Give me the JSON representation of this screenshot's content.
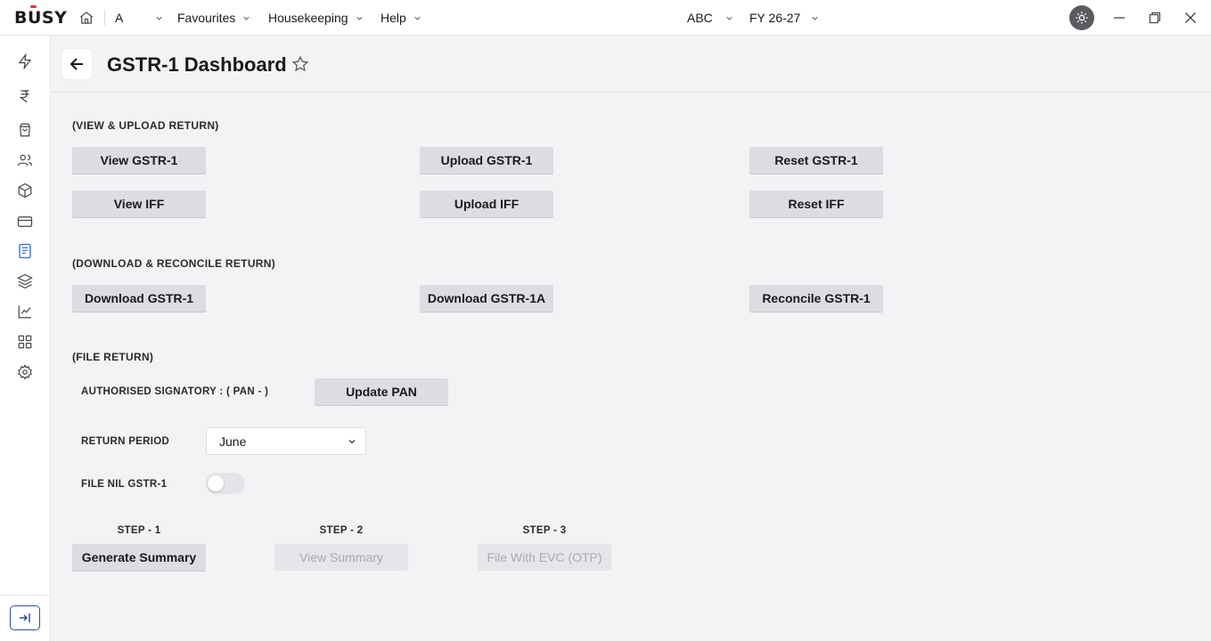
{
  "topbar": {
    "logo": "BUSY",
    "company_short": "A",
    "menus": [
      "Favourites",
      "Housekeeping",
      "Help"
    ],
    "company": "ABC",
    "fiscal_year": "FY 26-27"
  },
  "header": {
    "title": "GSTR-1 Dashboard"
  },
  "view_upload": {
    "label": "(VIEW & UPLOAD RETURN)",
    "view_gstr1": "View GSTR-1",
    "upload_gstr1": "Upload GSTR-1",
    "reset_gstr1": "Reset GSTR-1",
    "view_iff": "View IFF",
    "upload_iff": "Upload IFF",
    "reset_iff": "Reset IFF"
  },
  "download": {
    "label": "(DOWNLOAD & RECONCILE RETURN)",
    "download_gstr1": "Download GSTR-1",
    "download_gstr1a": "Download GSTR-1A",
    "reconcile_gstr1": "Reconcile GSTR-1"
  },
  "file_return": {
    "label": "(FILE RETURN)",
    "signatory_label": "AUTHORISED SIGNATORY : ( PAN -  )",
    "update_pan": "Update PAN",
    "return_period_label": "RETURN PERIOD",
    "return_period_value": "June",
    "file_nil_label": "FILE NIL GSTR-1",
    "file_nil_on": false,
    "steps": [
      {
        "label": "STEP - 1",
        "button": "Generate Summary",
        "enabled": true
      },
      {
        "label": "STEP - 2",
        "button": "View Summary",
        "enabled": false
      },
      {
        "label": "STEP - 3",
        "button": "File With EVC (OTP)",
        "enabled": false
      }
    ]
  },
  "sidebar": {
    "icons": [
      "lightning-icon",
      "rupee-icon",
      "shopping-bag-icon",
      "users-icon",
      "box-icon",
      "card-icon",
      "document-icon",
      "layers-icon",
      "chart-icon",
      "grid-icon",
      "gear-icon"
    ],
    "active": "document-icon"
  },
  "colors": {
    "accent": "#2b4f9e",
    "logo_red": "#e53935",
    "button_bg": "#dcdce2",
    "background": "#f3f3f5"
  }
}
